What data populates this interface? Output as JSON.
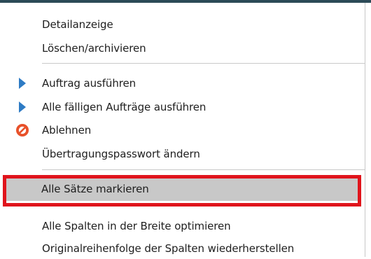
{
  "menu": {
    "items": [
      {
        "label": "Detailanzeige",
        "icon": null
      },
      {
        "label": "Löschen/archivieren",
        "icon": null
      },
      {
        "label": "Auftrag ausführen",
        "icon": "play-triangle-icon"
      },
      {
        "label": "Alle fälligen Aufträge ausführen",
        "icon": "play-triangle-icon"
      },
      {
        "label": "Ablehnen",
        "icon": "reject-circle-icon"
      },
      {
        "label": "Übertragungspasswort ändern",
        "icon": null
      },
      {
        "label": "Alle Sätze markieren",
        "icon": null,
        "selected": true
      },
      {
        "label": "Alle Spalten in der Breite optimieren",
        "icon": null
      },
      {
        "label": "Originalreihenfolge der Spalten wiederherstellen",
        "icon": null
      }
    ]
  },
  "colors": {
    "accent_blue": "#2e7bc4",
    "reject_red": "#e8512a",
    "highlight_red": "#e0141c",
    "selected_gray": "#c8c8c8"
  }
}
